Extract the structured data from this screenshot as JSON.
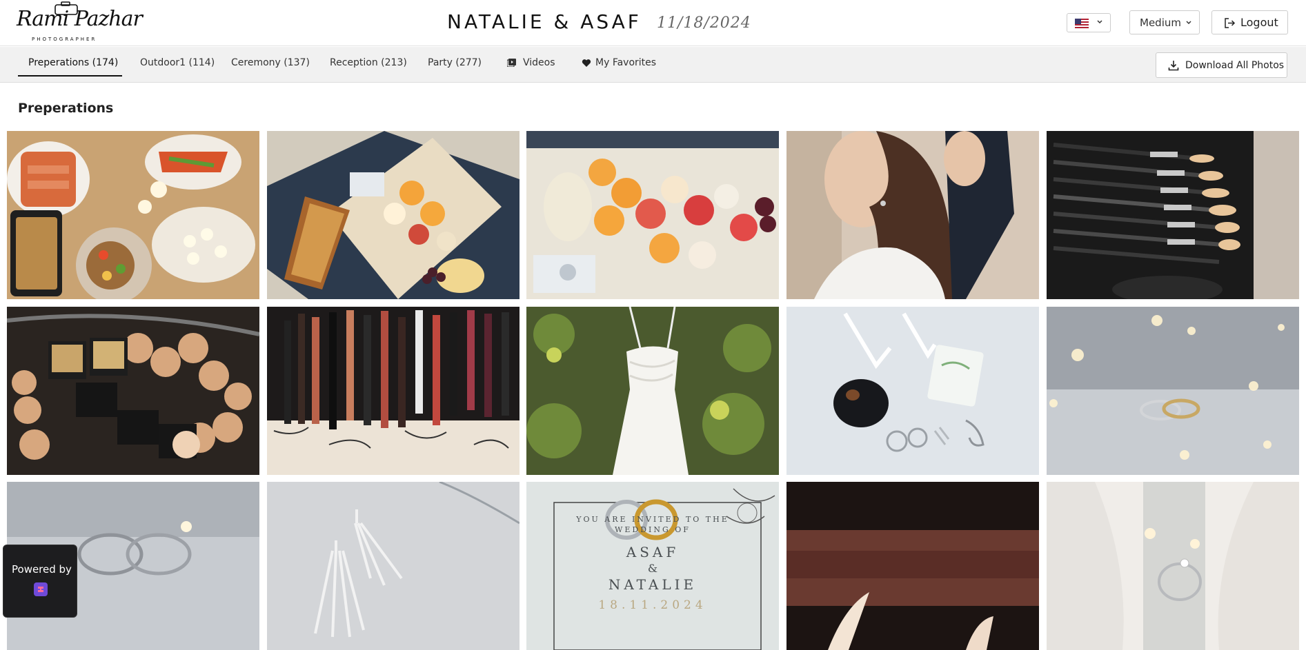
{
  "header": {
    "logo_script": "Rami Pazhar",
    "logo_sub": "PHOTOGRAPHER",
    "event_title": "NATALIE & ASAF",
    "event_date": "11/18/2024",
    "language_icon": "us-flag-icon",
    "size_selected": "Medium",
    "logout_label": "Logout"
  },
  "tabs": [
    {
      "label": "Preperations (174)",
      "active": true
    },
    {
      "label": "Outdoor1 (114)"
    },
    {
      "label": "Ceremony (137)"
    },
    {
      "label": "Reception (213)"
    },
    {
      "label": "Party (277)"
    },
    {
      "label": "Videos",
      "icon": "video-icon"
    },
    {
      "label": "My Favorites",
      "icon": "heart-icon"
    }
  ],
  "download_all_label": "Download All Photos",
  "section_title": "Preperations",
  "photos": [
    {
      "subject": "food-platters"
    },
    {
      "subject": "fruit-board"
    },
    {
      "subject": "sliced-fruit"
    },
    {
      "subject": "bride-hair"
    },
    {
      "subject": "makeup-brushes"
    },
    {
      "subject": "cosmetics-bag"
    },
    {
      "subject": "lip-pencils"
    },
    {
      "subject": "wedding-dress"
    },
    {
      "subject": "shoes-perfume"
    },
    {
      "subject": "ring-bokeh"
    },
    {
      "subject": "rings-pair"
    },
    {
      "subject": "earrings"
    },
    {
      "subject": "invitation-rings"
    },
    {
      "subject": "blurred-detail"
    },
    {
      "subject": "ring-closeup"
    }
  ],
  "invitation": {
    "line1": "YOU ARE INVITED TO THE",
    "line2": "WEDDING OF",
    "name1": "ASAF",
    "amp": "&",
    "name2": "NATALIE",
    "date": "18.11.2024"
  },
  "powered_by": "Powered by",
  "colors": {
    "tabbar_bg": "#f1f1f1",
    "active_underline": "#111111",
    "badge_bg": "#1d1d1f"
  }
}
